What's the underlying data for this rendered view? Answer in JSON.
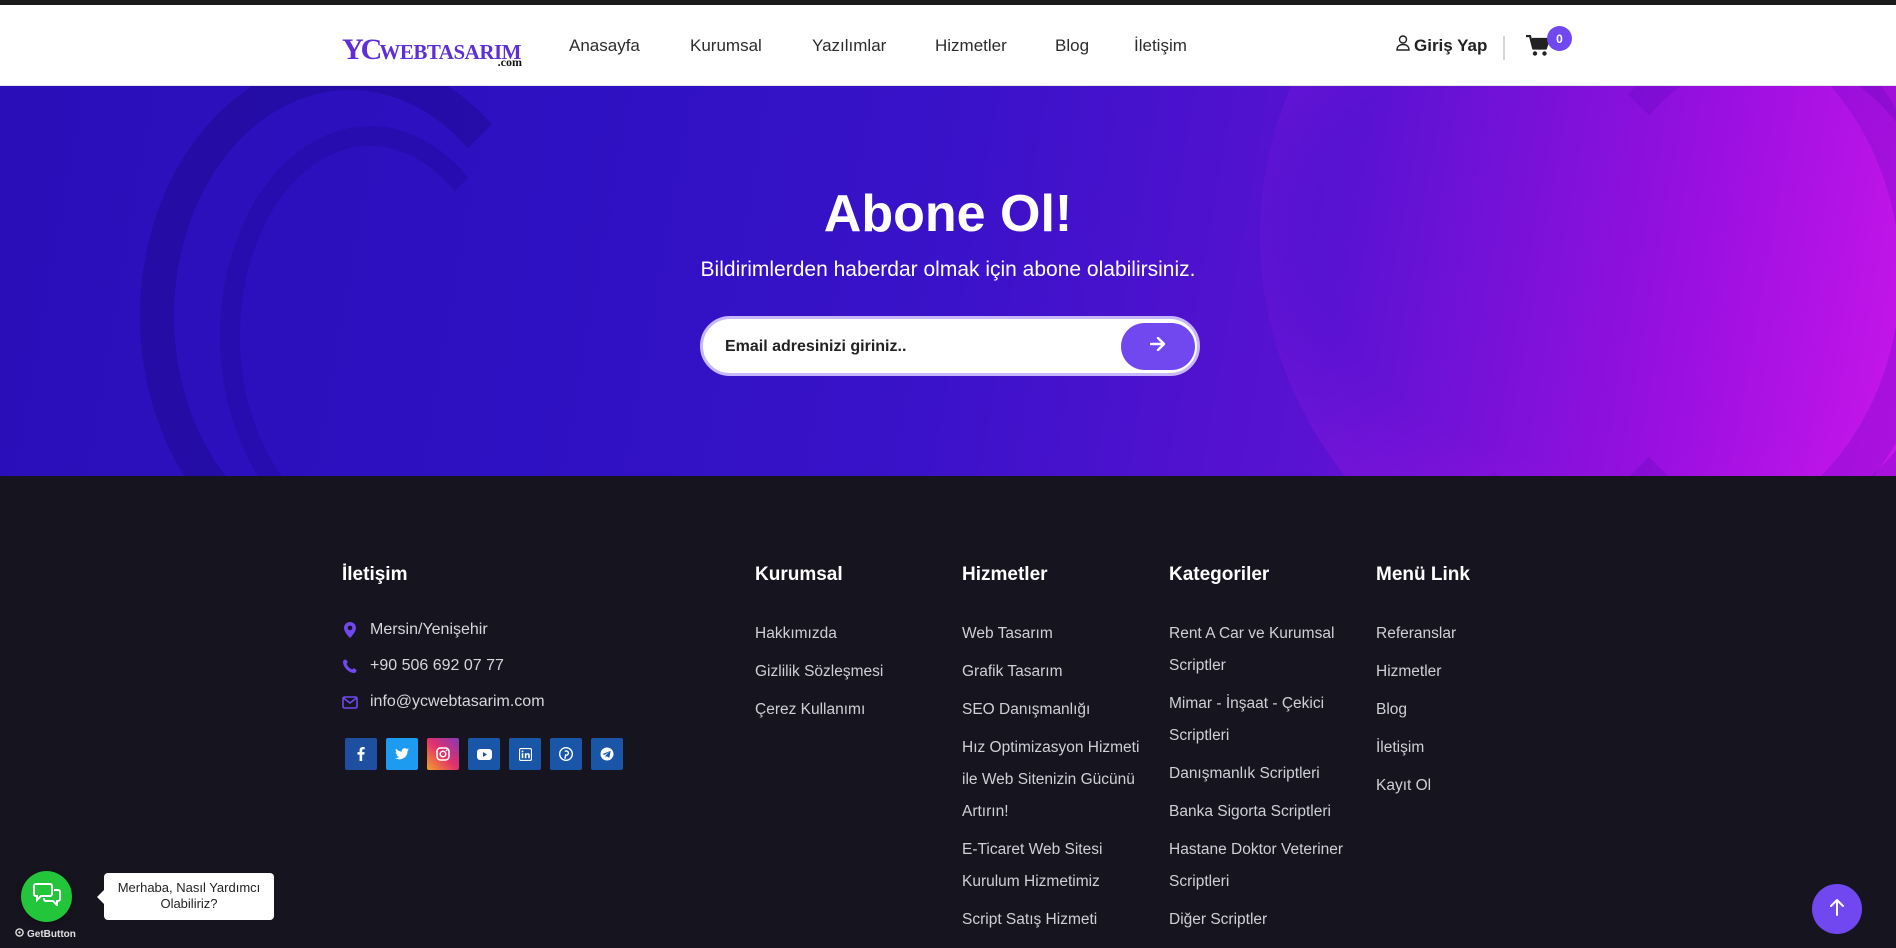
{
  "header": {
    "logo_main": "YCWEBTASARIM",
    "logo_yc": "YC",
    "logo_rest": "WEBTASARIM",
    "logo_com": ".com",
    "nav": [
      "Anasayfa",
      "Kurumsal",
      "Yazılımlar",
      "Hizmetler",
      "Blog",
      "İletişim"
    ],
    "login_label": "Giriş Yap",
    "cart_count": "0"
  },
  "hero": {
    "title": "Abone Ol!",
    "subtitle": "Bildirimlerden haberdar olmak için abone olabilirsiniz.",
    "email_placeholder": "Email adresinizi giriniz.."
  },
  "footer": {
    "contact": {
      "title": "İletişim",
      "address": "Mersin/Yenişehir",
      "phone": "+90 506 692 07 77",
      "email": "info@ycwebtasarim.com",
      "socials": [
        "facebook",
        "twitter",
        "instagram",
        "youtube",
        "linkedin",
        "pinterest",
        "telegram"
      ]
    },
    "kurumsal": {
      "title": "Kurumsal",
      "links": [
        "Hakkımızda",
        "Gizlilik Sözleşmesi",
        "Çerez Kullanımı"
      ]
    },
    "hizmetler": {
      "title": "Hizmetler",
      "links": [
        "Web Tasarım",
        "Grafik Tasarım",
        "SEO Danışmanlığı",
        "Hız Optimizasyon Hizmeti ile Web Sitenizin Gücünü Artırın!",
        "E-Ticaret Web Sitesi Kurulum Hizmetimiz",
        "Script Satış Hizmeti"
      ]
    },
    "kategoriler": {
      "title": "Kategoriler",
      "links": [
        "Rent A Car ve Kurumsal Scriptler",
        "Mimar - İnşaat - Çekici Scriptleri",
        "Danışmanlık Scriptleri",
        "Banka Sigorta Scriptleri",
        "Hastane Doktor Veteriner Scriptleri",
        "Diğer Scriptler"
      ]
    },
    "menu": {
      "title": "Menü Link",
      "links": [
        "Referanslar",
        "Hizmetler",
        "Blog",
        "İletişim",
        "Kayıt Ol"
      ]
    }
  },
  "widgets": {
    "chat_text": "Merhaba, Nasıl Yardımcı Olabiliriz?",
    "getbutton": "GetButton"
  },
  "colors": {
    "accent": "#7148f0",
    "footer_bg": "#16151f",
    "chat_green": "#23c53a"
  }
}
